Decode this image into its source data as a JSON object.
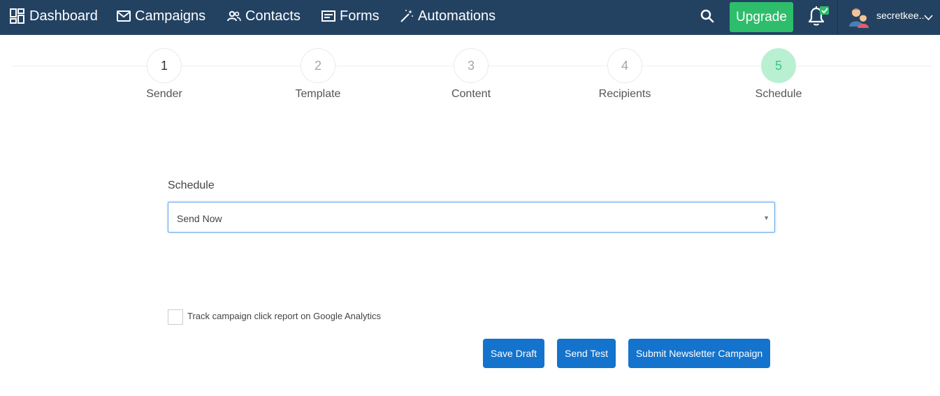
{
  "nav": {
    "items": [
      {
        "label": "Dashboard",
        "icon": "dashboard-icon"
      },
      {
        "label": "Campaigns",
        "icon": "envelope-icon"
      },
      {
        "label": "Contacts",
        "icon": "contacts-icon"
      },
      {
        "label": "Forms",
        "icon": "form-icon"
      },
      {
        "label": "Automations",
        "icon": "magic-wand-icon"
      }
    ],
    "upgrade_label": "Upgrade",
    "username": "secretkee..."
  },
  "steps": [
    {
      "number": "1",
      "label": "Sender"
    },
    {
      "number": "2",
      "label": "Template"
    },
    {
      "number": "3",
      "label": "Content"
    },
    {
      "number": "4",
      "label": "Recipients"
    },
    {
      "number": "5",
      "label": "Schedule"
    }
  ],
  "form": {
    "schedule_label": "Schedule",
    "schedule_value": "Send Now",
    "track_label": "Track campaign click report on Google Analytics"
  },
  "buttons": {
    "save_draft": "Save Draft",
    "send_test": "Send Test",
    "submit": "Submit Newsletter Campaign"
  },
  "colors": {
    "topbar": "#234262",
    "upgrade": "#2ebd6b",
    "primary_button": "#1473cc",
    "active_step": "#b9f0d1"
  }
}
